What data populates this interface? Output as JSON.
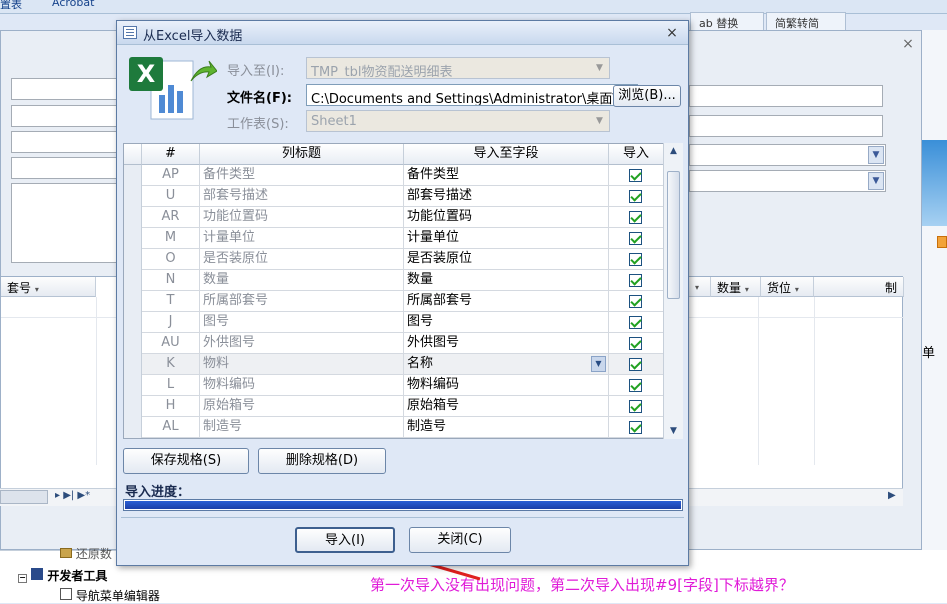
{
  "background": {
    "top_strip_items": [
      "置表",
      "Acrobat"
    ],
    "tabs": [
      "ab 替换",
      "简繁转简"
    ],
    "grid_headers": [
      "套号",
      "数量",
      "货位",
      "制"
    ],
    "right_text": "单",
    "nav_items": [
      "还原数",
      "开发者工具",
      "导航菜单编辑器"
    ]
  },
  "dialog": {
    "title": "从Excel导入数据",
    "close_glyph": "×",
    "import_to_label": "导入至(I):",
    "import_to_value": "TMP_tbl物资配送明细表",
    "filename_label": "文件名(F):",
    "filename_value": "C:\\Documents and Settings\\Administrator\\桌面\\副",
    "browse_button": "浏览(B)...",
    "sheet_label": "工作表(S):",
    "sheet_value": "Sheet1",
    "columns": [
      "#",
      "列标题",
      "导入至字段",
      "导入"
    ],
    "rows": [
      {
        "code": "AP",
        "title": "备件类型",
        "field": "备件类型",
        "checked": true
      },
      {
        "code": "U",
        "title": "部套号描述",
        "field": "部套号描述",
        "checked": true
      },
      {
        "code": "AR",
        "title": "功能位置码",
        "field": "功能位置码",
        "checked": true
      },
      {
        "code": "M",
        "title": "计量单位",
        "field": "计量单位",
        "checked": true
      },
      {
        "code": "O",
        "title": "是否装原位",
        "field": "是否装原位",
        "checked": true
      },
      {
        "code": "N",
        "title": "数量",
        "field": "数量",
        "checked": true
      },
      {
        "code": "T",
        "title": "所属部套号",
        "field": "所属部套号",
        "checked": true
      },
      {
        "code": "J",
        "title": "图号",
        "field": "图号",
        "checked": true
      },
      {
        "code": "AU",
        "title": "外供图号",
        "field": "外供图号",
        "checked": true
      },
      {
        "code": "K",
        "title": "物料",
        "field": "名称",
        "checked": true
      },
      {
        "code": "L",
        "title": "物料编码",
        "field": "物料编码",
        "checked": true
      },
      {
        "code": "H",
        "title": "原始箱号",
        "field": "原始箱号",
        "checked": true
      },
      {
        "code": "AL",
        "title": "制造号",
        "field": "制造号",
        "checked": true
      }
    ],
    "save_spec_button": "保存规格(S)",
    "delete_spec_button": "删除规格(D)",
    "progress_label": "导入进度：",
    "progress_value": 1.0,
    "import_button": "导入(I)",
    "close_button": "关闭(C)"
  },
  "annotation": "第一次导入没有出现问题，第二次导入出现#9[字段]下标越界？",
  "colors": {
    "annotation": "#e01bd8",
    "arrow": "#e0201f",
    "progress": "#1f47c0",
    "check": "#21a121"
  }
}
